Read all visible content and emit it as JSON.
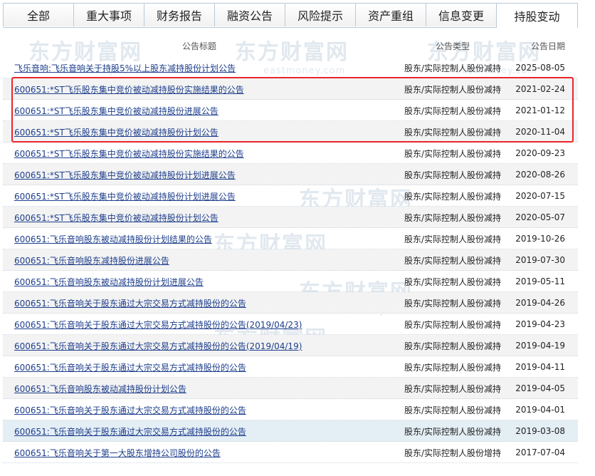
{
  "tabs": [
    {
      "label": "全部",
      "active": false
    },
    {
      "label": "重大事项",
      "active": false
    },
    {
      "label": "财务报告",
      "active": false
    },
    {
      "label": "融资公告",
      "active": false
    },
    {
      "label": "风险提示",
      "active": false
    },
    {
      "label": "资产重组",
      "active": false
    },
    {
      "label": "信息变更",
      "active": false
    },
    {
      "label": "持股变动",
      "active": true
    }
  ],
  "watermark": {
    "brand": "东方财富网",
    "domain": "eastmoney.com"
  },
  "table": {
    "headers": {
      "title": "公告标题",
      "type": "公告类型",
      "date": "公告日期"
    },
    "rows": [
      {
        "title": "飞乐音响:飞乐音响关于持股5%以上股东减持股份计划公告",
        "type": "股东/实际控制人股份减持",
        "date": "2025-08-05"
      },
      {
        "title": "600651:*ST飞乐股东集中竞价被动减持股份实施结果的公告",
        "type": "股东/实际控制人股份减持",
        "date": "2021-02-24"
      },
      {
        "title": "600651:*ST飞乐股东集中竞价被动减持股份进展公告",
        "type": "股东/实际控制人股份减持",
        "date": "2021-01-12"
      },
      {
        "title": "600651:*ST飞乐股东集中竞价被动减持股份计划公告",
        "type": "股东/实际控制人股份减持",
        "date": "2020-11-04"
      },
      {
        "title": "600651:*ST飞乐股东集中竞价被动减持股份实施结果的公告",
        "type": "股东/实际控制人股份减持",
        "date": "2020-09-23"
      },
      {
        "title": "600651:*ST飞乐股东集中竞价被动减持股份计划进展公告",
        "type": "股东/实际控制人股份减持",
        "date": "2020-08-26"
      },
      {
        "title": "600651:*ST飞乐股东集中竞价被动减持股份计划进展公告",
        "type": "股东/实际控制人股份减持",
        "date": "2020-07-15"
      },
      {
        "title": "600651:*ST飞乐股东集中竞价被动减持股份计划公告",
        "type": "股东/实际控制人股份减持",
        "date": "2020-05-07"
      },
      {
        "title": "600651:飞乐音响股东被动减持股份计划结果的公告",
        "type": "股东/实际控制人股份减持",
        "date": "2019-10-26"
      },
      {
        "title": "600651:飞乐音响股东减持股份进展公告",
        "type": "股东/实际控制人股份减持",
        "date": "2019-07-30"
      },
      {
        "title": "600651:飞乐音响股东被动减持股份计划进展公告",
        "type": "股东/实际控制人股份减持",
        "date": "2019-05-11"
      },
      {
        "title": "600651:飞乐音响关于股东通过大宗交易方式减持股份的公告",
        "type": "股东/实际控制人股份减持",
        "date": "2019-04-26"
      },
      {
        "title": "600651:飞乐音响关于股东通过大宗交易方式减持股份的公告(2019/04/23)",
        "type": "股东/实际控制人股份减持",
        "date": "2019-04-23"
      },
      {
        "title": "600651:飞乐音响关于股东通过大宗交易方式减持股份的公告(2019/04/19)",
        "type": "股东/实际控制人股份减持",
        "date": "2019-04-19"
      },
      {
        "title": "600651:飞乐音响关于股东通过大宗交易方式减持股份的公告",
        "type": "股东/实际控制人股份减持",
        "date": "2019-04-11"
      },
      {
        "title": "600651:飞乐音响股东被动减持股份计划公告",
        "type": "股东/实际控制人股份减持",
        "date": "2019-04-05"
      },
      {
        "title": "600651:飞乐音响关于股东通过大宗交易方式减持股份的公告",
        "type": "股东/实际控制人股份减持",
        "date": "2019-04-01"
      },
      {
        "title": "600651:飞乐音响关于股东通过大宗交易方式减持股份的公告",
        "type": "股东/实际控制人股份减持",
        "date": "2019-03-08"
      },
      {
        "title": "600651:飞乐音响关于第一大股东增持公司股份的公告",
        "type": "股东/实际控制人股份增持",
        "date": "2017-07-04"
      }
    ]
  }
}
